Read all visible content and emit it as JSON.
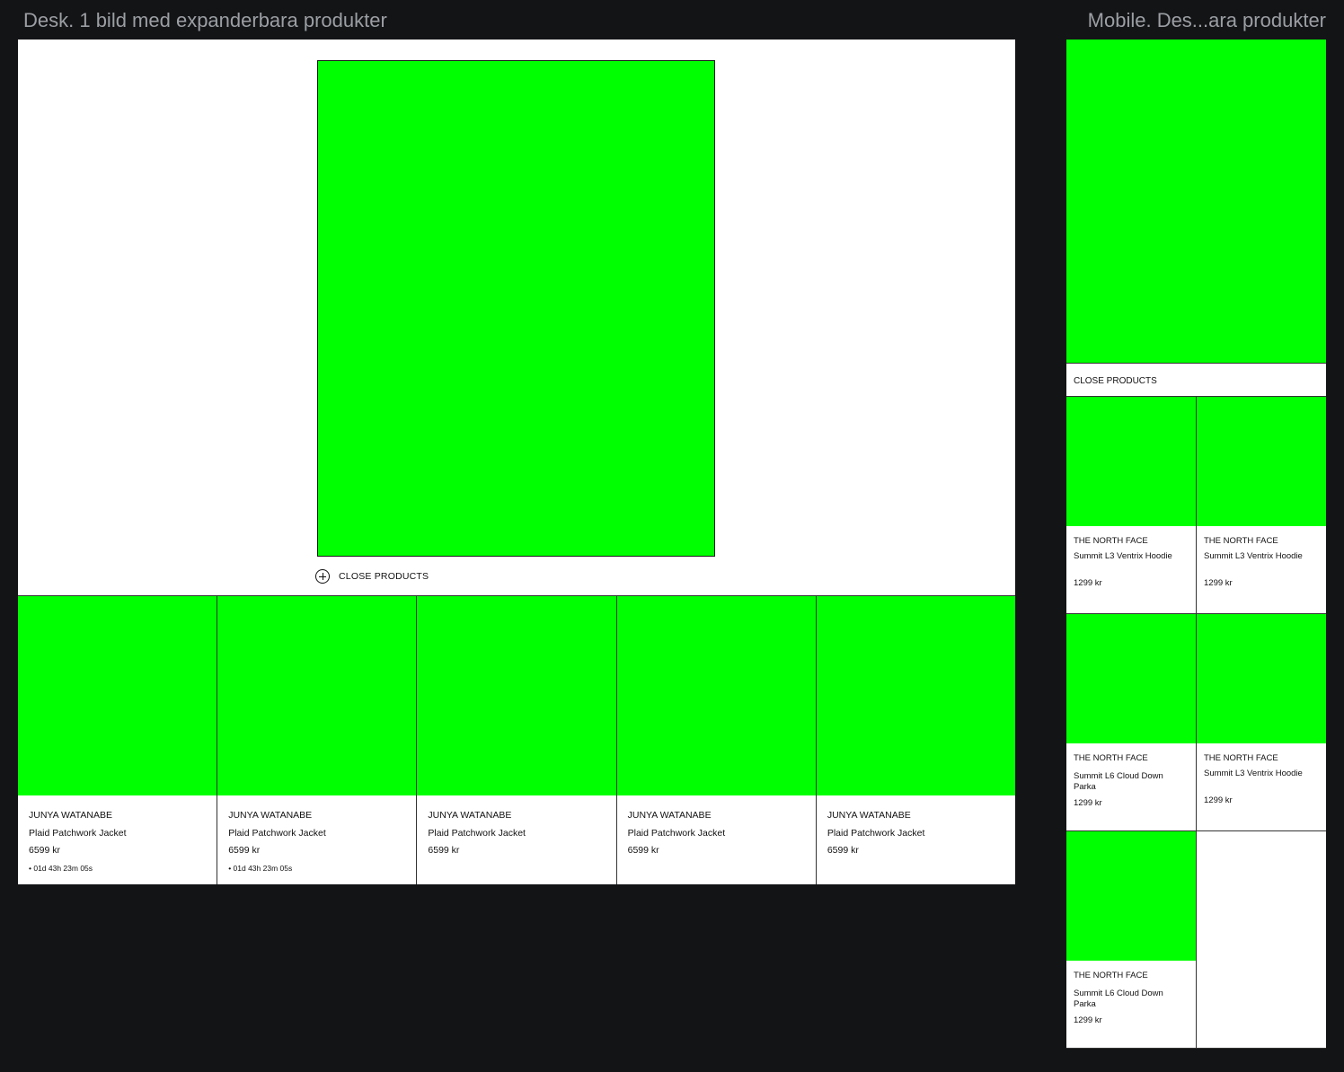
{
  "frames": {
    "desktop_label": "Desk. 1 bild med expanderbara produkter",
    "mobile_label": "Mobile. Des...ara produkter"
  },
  "colors": {
    "placeholder": "#00ff00",
    "canvas_bg": "#131416",
    "label_text": "#9b9ea3"
  },
  "desktop": {
    "close_label": "CLOSE PRODUCTS",
    "close_icon": "circle-plus-icon",
    "products": [
      {
        "brand": "JUNYA WATANABE",
        "name": "Plaid Patchwork Jacket",
        "price": "6599 kr",
        "timer": "• 01d 43h 23m 05s"
      },
      {
        "brand": "JUNYA WATANABE",
        "name": "Plaid Patchwork Jacket",
        "price": "6599 kr",
        "timer": "• 01d 43h 23m 05s"
      },
      {
        "brand": "JUNYA WATANABE",
        "name": "Plaid Patchwork Jacket",
        "price": "6599 kr",
        "timer": ""
      },
      {
        "brand": "JUNYA WATANABE",
        "name": "Plaid Patchwork Jacket",
        "price": "6599 kr",
        "timer": ""
      },
      {
        "brand": "JUNYA WATANABE",
        "name": "Plaid Patchwork Jacket",
        "price": "6599 kr",
        "timer": ""
      }
    ]
  },
  "mobile": {
    "close_label": "CLOSE PRODUCTS",
    "products": [
      {
        "brand": "THE NORTH FACE",
        "name": "Summit L3 Ventrix Hoodie",
        "price": "1299 kr"
      },
      {
        "brand": "THE NORTH FACE",
        "name": "Summit L3 Ventrix Hoodie",
        "price": "1299 kr"
      },
      {
        "brand": "THE NORTH FACE",
        "name": "Summit L6 Cloud Down Parka",
        "price": "1299 kr"
      },
      {
        "brand": "THE NORTH FACE",
        "name": "Summit L3 Ventrix Hoodie",
        "price": "1299 kr"
      },
      {
        "brand": "THE NORTH FACE",
        "name": "Summit L6 Cloud Down Parka",
        "price": "1299 kr"
      }
    ]
  }
}
